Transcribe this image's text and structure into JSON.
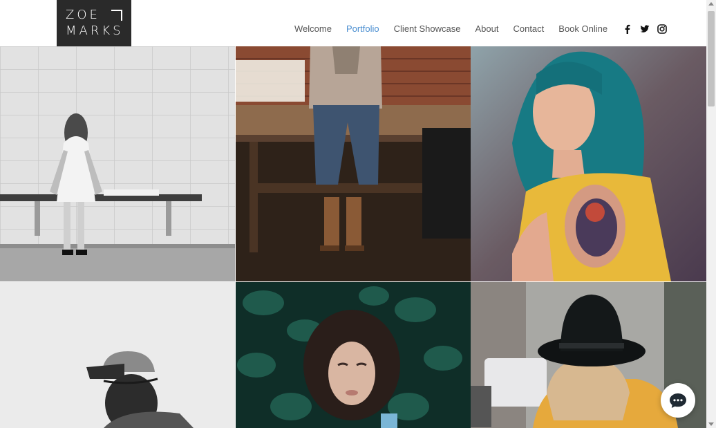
{
  "logo": {
    "line1": "ZOE",
    "line2": "MARKS"
  },
  "nav": {
    "items": [
      {
        "label": "Welcome",
        "active": false
      },
      {
        "label": "Portfolio",
        "active": true
      },
      {
        "label": "Client Showcase",
        "active": false
      },
      {
        "label": "About",
        "active": false
      },
      {
        "label": "Contact",
        "active": false
      },
      {
        "label": "Book Online",
        "active": false
      }
    ]
  },
  "social": [
    "facebook-icon",
    "twitter-icon",
    "instagram-icon"
  ],
  "gallery": {
    "photos": [
      "black and white photo of woman sitting on bench",
      "woman sitting on wooden table in brown boots",
      "woman with teal hair and tattoo",
      "black and white photo of smiling person in cap",
      "woman lying among green leaves",
      "person in black hat seen from behind"
    ]
  },
  "colors": {
    "accent": "#4a8ed0",
    "logo_bg": "#2a2a2a",
    "nav_text": "#555555"
  }
}
